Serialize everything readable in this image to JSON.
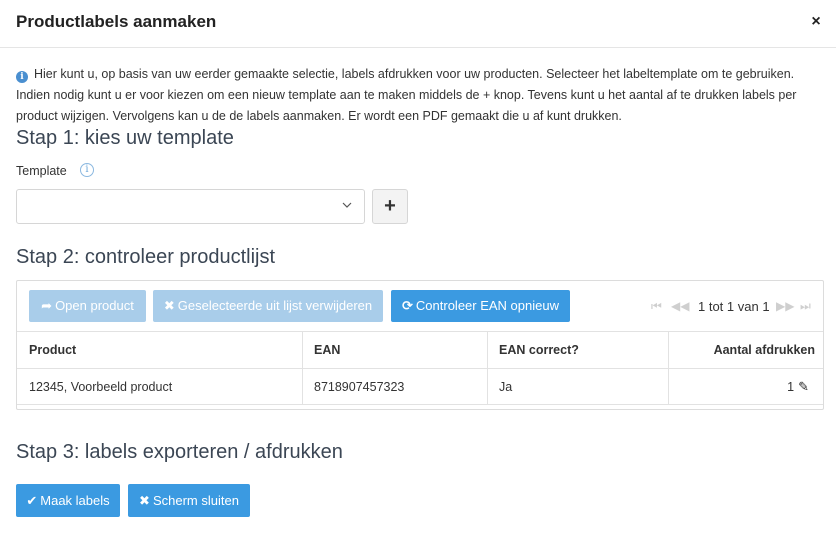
{
  "dialog": {
    "title": "Productlabels aanmaken",
    "close_symbol": "×"
  },
  "intro": {
    "icon": "info-icon",
    "text": "Hier kunt u, op basis van uw eerder gemaakte selectie, labels afdrukken voor uw producten. Selecteer het labeltemplate om te gebruiken. Indien nodig kunt u er voor kiezen om een nieuw template aan te maken middels de + knop. Tevens kunt u het aantal af te drukken labels per product wijzigen. Vervolgens kan u de de labels aanmaken. Er wordt een PDF gemaakt die u af kunt drukken."
  },
  "step1": {
    "heading": "Stap 1: kies uw template",
    "template_label": "Template",
    "template_value": "",
    "add_symbol": "+"
  },
  "step2": {
    "heading": "Stap 2: controleer productlijst",
    "toolbar": {
      "open_product": "Open product",
      "remove_selected": "Geselecteerde uit lijst verwijderen",
      "recheck_ean": "Controleer EAN opnieuw"
    },
    "pager": {
      "text": "1 tot 1 van 1",
      "first": "⏮",
      "prev": "◀◀",
      "next": "▶▶",
      "last": "⏭"
    },
    "table": {
      "headers": [
        "Product",
        "EAN",
        "EAN correct?",
        "Aantal afdrukken"
      ],
      "rows": [
        {
          "product": "12345, Voorbeeld product",
          "ean": "8718907457323",
          "ean_correct": "Ja",
          "aantal": "1"
        }
      ]
    }
  },
  "step3": {
    "heading": "Stap 3: labels exporteren / afdrukken",
    "make_labels": "Maak labels",
    "close_screen": "Scherm sluiten"
  },
  "colors": {
    "primary": "#3b9ae1",
    "disabled": "#a9cdea",
    "heading": "#3b4654"
  }
}
